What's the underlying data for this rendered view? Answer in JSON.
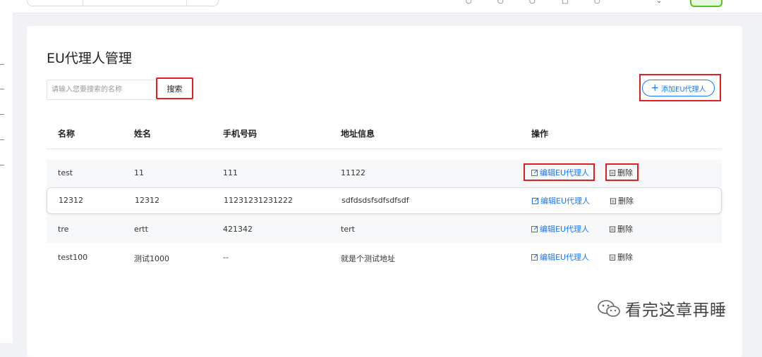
{
  "page": {
    "title": "EU代理人管理"
  },
  "search": {
    "placeholder": "请输入您要搜索的名称",
    "value": "",
    "button_label": "搜索"
  },
  "actions": {
    "add_label": "添加EU代理人"
  },
  "table": {
    "headers": {
      "name": "名称",
      "fullname": "姓名",
      "phone": "手机号码",
      "address": "地址信息",
      "ops": "操作"
    },
    "rows": [
      {
        "name": "test",
        "fullname": "11",
        "phone": "111",
        "address": "11122",
        "edit": "编辑EU代理人",
        "delete": "删除"
      },
      {
        "name": "12312",
        "fullname": "12312",
        "phone": "11231231231222",
        "address": "sdfdsdsfsdfsdfsdf",
        "edit": "编辑EU代理人",
        "delete": "删除"
      },
      {
        "name": "tre",
        "fullname": "ertt",
        "phone": "421342",
        "address": "tert",
        "edit": "编辑EU代理人",
        "delete": "删除"
      },
      {
        "name": "test100",
        "fullname": "测试1000",
        "phone": "--",
        "address": "就是个测试地址",
        "edit": "编辑EU代理人",
        "delete": "删除"
      }
    ]
  },
  "watermark": {
    "text": "看完这章再睡",
    "icon": "wechat-icon"
  },
  "colors": {
    "accent": "#1677ff",
    "highlight": "#e02020",
    "status_green": "#52c41a"
  }
}
